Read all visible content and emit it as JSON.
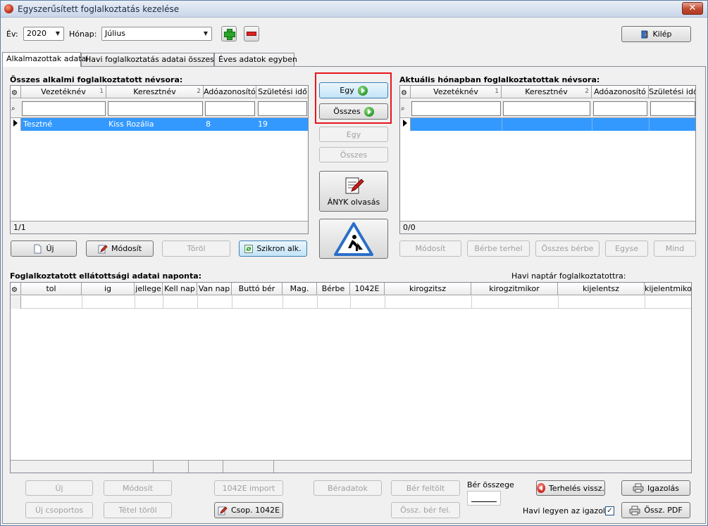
{
  "window": {
    "title": "Egyszerűsített foglalkoztatás kezelése",
    "close_label": "✕"
  },
  "toolbar": {
    "year_label": "Év:",
    "year_value": "2020",
    "month_label": "Hónap:",
    "month_value": "Július",
    "exit_label": "Kilép"
  },
  "tabs": [
    {
      "label": "Alkalmazottak adatai",
      "active": true
    },
    {
      "label": "Havi foglalkoztatás adatai összesítve",
      "active": false
    },
    {
      "label": "Éves adatok egyben",
      "active": false
    }
  ],
  "left_panel": {
    "title": "Összes alkalmi foglalkoztatott névsora:",
    "columns": [
      {
        "label": "Vezetéknév",
        "sort": "1"
      },
      {
        "label": "Keresztnév",
        "sort": "2"
      },
      {
        "label": "Adóazonosító",
        "sort": ""
      },
      {
        "label": "Születési idő",
        "sort": ""
      }
    ],
    "rows": [
      {
        "vezeteknev": "Tesztné",
        "keresztnev": "Kiss Rozália",
        "adoazonosito": "8",
        "szuletesi_ido": "19"
      }
    ],
    "footer": "1/1",
    "buttons": {
      "new": "Új",
      "modify": "Módosít",
      "delete": "Töröl",
      "sync": "Szikron alk."
    }
  },
  "middle": {
    "one_right": "Egy",
    "all_right": "Összes",
    "one_left": "Egy",
    "all_left": "Összes",
    "anyk": "ÁNYK olvasás"
  },
  "right_panel": {
    "title": "Aktuális hónapban foglalkoztatottak névsora:",
    "columns": [
      {
        "label": "Vezetéknév",
        "sort": "1"
      },
      {
        "label": "Keresztnév",
        "sort": "2"
      },
      {
        "label": "Adóazonosító",
        "sort": ""
      },
      {
        "label": "Születési idő",
        "sort": ""
      }
    ],
    "footer": "0/0",
    "buttons": {
      "modify": "Módosít",
      "lend": "Bérbe terhel",
      "all_lend": "Összes bérbe",
      "single": "Egyse",
      "all": "Mind"
    }
  },
  "daily": {
    "title": "Foglalkoztatott ellátottsági adatai naponta:",
    "calendar_label": "Havi naptár foglalkoztatottra:",
    "columns": [
      "tol",
      "ig",
      "jellege",
      "Kell nap",
      "Van nap",
      "Buttó bér",
      "Mag.",
      "Bérbe",
      "1042E",
      "kirogzitsz",
      "kirogzitmikor",
      "kijelentsz",
      "kijelentmikor"
    ]
  },
  "bottom": {
    "new": "Új",
    "modify": "Módosít",
    "import_1042e": "1042E import",
    "wage_data": "Béradatok",
    "wage_upload": "Bér feltölt",
    "wage_sum_label": "Bér összege",
    "charge_back": "Terhelés vissz.",
    "certificate": "Igazolás",
    "new_group": "Új csoportos",
    "delete_item": "Tétel töröl",
    "group_1042e": "Csop. 1042E",
    "sum_wage_upload": "Össz. bér fel.",
    "monthly_cert_label": "Havi legyen az igazolás",
    "monthly_cert_checked": true,
    "sum_pdf": "Össz. PDF"
  }
}
